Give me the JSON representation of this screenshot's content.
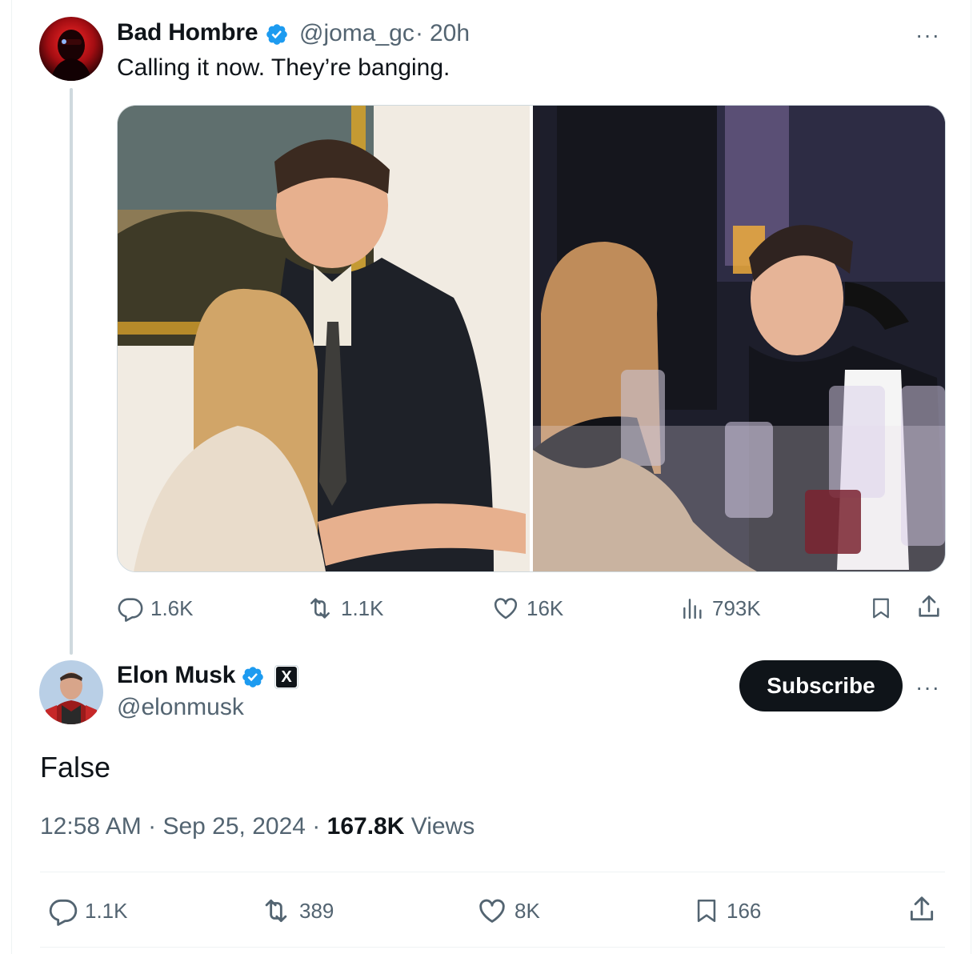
{
  "original_tweet": {
    "author_name": "Bad Hombre",
    "handle": "@joma_gc",
    "separator": "·",
    "time_ago": "20h",
    "text": "Calling it now. They’re banging.",
    "more_label": "···",
    "actions": {
      "replies": "1.6K",
      "reposts": "1.1K",
      "likes": "16K",
      "views": "793K"
    }
  },
  "reply_tweet": {
    "author_name": "Elon Musk",
    "handle": "@elonmusk",
    "affiliate_badge": "X",
    "subscribe_label": "Subscribe",
    "more_label": "···",
    "text": "False",
    "time": "12:58 AM",
    "separator": "·",
    "date": "Sep 25, 2024",
    "views_count": "167.8K",
    "views_label": "Views",
    "actions": {
      "replies": "1.1K",
      "reposts": "389",
      "likes": "8K",
      "bookmarks": "166"
    }
  },
  "colors": {
    "verified_blue": "#1d9bf0",
    "text_primary": "#0f1419",
    "text_secondary": "#536471",
    "button_bg": "#0f1419",
    "thread_line": "#cfd9de"
  },
  "icons": {
    "reply": "reply-icon",
    "repost": "repost-icon",
    "like": "heart-icon",
    "views": "views-icon",
    "bookmark": "bookmark-icon",
    "share": "share-icon",
    "verified": "verified-badge-icon"
  }
}
